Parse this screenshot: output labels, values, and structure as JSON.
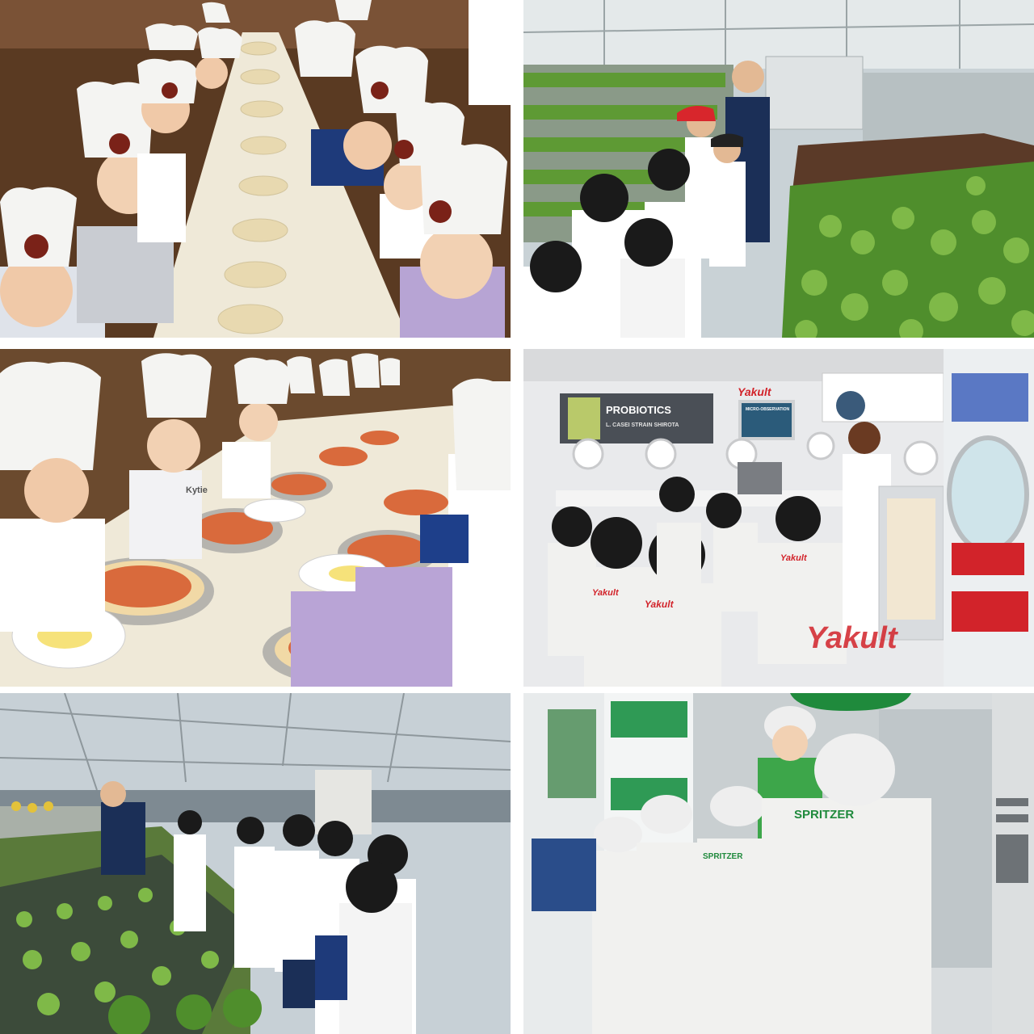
{
  "photos": [
    {
      "scene": "pizza-making-kids-seated",
      "name_tag": ""
    },
    {
      "scene": "hydroponic-farm-tour"
    },
    {
      "scene": "pizza-topping-activity",
      "name_tag": "Kytie"
    },
    {
      "scene": "yakult-probiotics-lab",
      "brand": "Yakult",
      "board_title": "PROBIOTICS",
      "board_sub": "L. CASEI STRAIN SHIROTA",
      "screen_label": "MICRO-OBSERVATION"
    },
    {
      "scene": "greenhouse-seedling-tour"
    },
    {
      "scene": "spritzer-factory-visit",
      "brand": "SPRITZER"
    }
  ],
  "colors": {
    "chef_hat": "#f4f4f2",
    "table": "#efe9d8",
    "lettuce": "#5e9a34",
    "yakult_red": "#d2232a",
    "spritzer_green": "#1f8a3c",
    "lab_coat": "#f1f1ef",
    "greenhouse_sky": "#c7d0d6"
  }
}
